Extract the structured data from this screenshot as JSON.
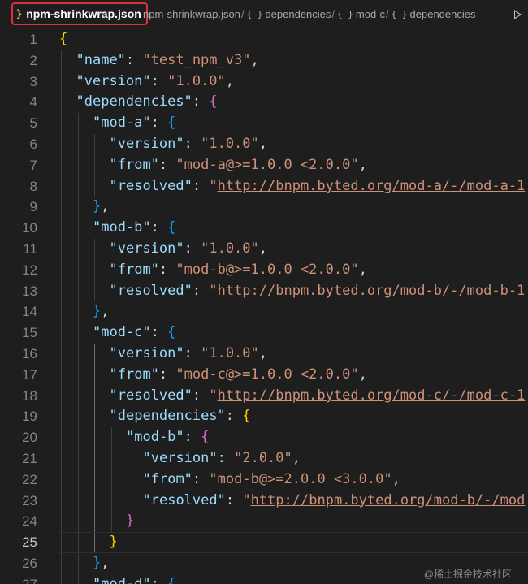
{
  "breadcrumbs": {
    "file": "npm-shrinkwrap.json",
    "file_icon": "}",
    "path": [
      {
        "label": "npm-shrinkwrap.json"
      },
      {
        "label": "dependencies"
      },
      {
        "label": "mod-c"
      },
      {
        "label": "dependencies"
      }
    ],
    "object_icon": "{ }",
    "separator": "/"
  },
  "editor": {
    "current_line": 25,
    "lines": [
      {
        "n": "1",
        "indent": 0,
        "tokens": [
          {
            "t": "{",
            "c": "b1"
          }
        ]
      },
      {
        "n": "2",
        "indent": 1,
        "tokens": [
          {
            "t": "\"name\"",
            "c": "key"
          },
          {
            "t": ": ",
            "c": "p"
          },
          {
            "t": "\"test_npm_v3\"",
            "c": "str"
          },
          {
            "t": ",",
            "c": "p"
          }
        ]
      },
      {
        "n": "3",
        "indent": 1,
        "tokens": [
          {
            "t": "\"version\"",
            "c": "key"
          },
          {
            "t": ": ",
            "c": "p"
          },
          {
            "t": "\"1.0.0\"",
            "c": "str"
          },
          {
            "t": ",",
            "c": "p"
          }
        ]
      },
      {
        "n": "4",
        "indent": 1,
        "tokens": [
          {
            "t": "\"dependencies\"",
            "c": "key"
          },
          {
            "t": ": ",
            "c": "p"
          },
          {
            "t": "{",
            "c": "b2"
          }
        ]
      },
      {
        "n": "5",
        "indent": 2,
        "tokens": [
          {
            "t": "\"mod-a\"",
            "c": "key"
          },
          {
            "t": ": ",
            "c": "p"
          },
          {
            "t": "{",
            "c": "b3"
          }
        ]
      },
      {
        "n": "6",
        "indent": 3,
        "tokens": [
          {
            "t": "\"version\"",
            "c": "key"
          },
          {
            "t": ": ",
            "c": "p"
          },
          {
            "t": "\"1.0.0\"",
            "c": "str"
          },
          {
            "t": ",",
            "c": "p"
          }
        ]
      },
      {
        "n": "7",
        "indent": 3,
        "tokens": [
          {
            "t": "\"from\"",
            "c": "key"
          },
          {
            "t": ": ",
            "c": "p"
          },
          {
            "t": "\"mod-a@>=1.0.0 <2.0.0\"",
            "c": "str"
          },
          {
            "t": ",",
            "c": "p"
          }
        ]
      },
      {
        "n": "8",
        "indent": 3,
        "tokens": [
          {
            "t": "\"resolved\"",
            "c": "key"
          },
          {
            "t": ": ",
            "c": "p"
          },
          {
            "t": "\"",
            "c": "str"
          },
          {
            "t": "http://bnpm.byted.org/mod-a/-/mod-a-1",
            "c": "url"
          }
        ]
      },
      {
        "n": "9",
        "indent": 2,
        "tokens": [
          {
            "t": "}",
            "c": "b3"
          },
          {
            "t": ",",
            "c": "p"
          }
        ]
      },
      {
        "n": "10",
        "indent": 2,
        "tokens": [
          {
            "t": "\"mod-b\"",
            "c": "key"
          },
          {
            "t": ": ",
            "c": "p"
          },
          {
            "t": "{",
            "c": "b3"
          }
        ]
      },
      {
        "n": "11",
        "indent": 3,
        "tokens": [
          {
            "t": "\"version\"",
            "c": "key"
          },
          {
            "t": ": ",
            "c": "p"
          },
          {
            "t": "\"1.0.0\"",
            "c": "str"
          },
          {
            "t": ",",
            "c": "p"
          }
        ]
      },
      {
        "n": "12",
        "indent": 3,
        "tokens": [
          {
            "t": "\"from\"",
            "c": "key"
          },
          {
            "t": ": ",
            "c": "p"
          },
          {
            "t": "\"mod-b@>=1.0.0 <2.0.0\"",
            "c": "str"
          },
          {
            "t": ",",
            "c": "p"
          }
        ]
      },
      {
        "n": "13",
        "indent": 3,
        "tokens": [
          {
            "t": "\"resolved\"",
            "c": "key"
          },
          {
            "t": ": ",
            "c": "p"
          },
          {
            "t": "\"",
            "c": "str"
          },
          {
            "t": "http://bnpm.byted.org/mod-b/-/mod-b-1",
            "c": "url"
          }
        ]
      },
      {
        "n": "14",
        "indent": 2,
        "tokens": [
          {
            "t": "}",
            "c": "b3"
          },
          {
            "t": ",",
            "c": "p"
          }
        ]
      },
      {
        "n": "15",
        "indent": 2,
        "tokens": [
          {
            "t": "\"mod-c\"",
            "c": "key"
          },
          {
            "t": ": ",
            "c": "p"
          },
          {
            "t": "{",
            "c": "b3"
          }
        ]
      },
      {
        "n": "16",
        "indent": 3,
        "tokens": [
          {
            "t": "\"version\"",
            "c": "key"
          },
          {
            "t": ": ",
            "c": "p"
          },
          {
            "t": "\"1.0.0\"",
            "c": "str"
          },
          {
            "t": ",",
            "c": "p"
          }
        ]
      },
      {
        "n": "17",
        "indent": 3,
        "tokens": [
          {
            "t": "\"from\"",
            "c": "key"
          },
          {
            "t": ": ",
            "c": "p"
          },
          {
            "t": "\"mod-c@>=1.0.0 <2.0.0\"",
            "c": "str"
          },
          {
            "t": ",",
            "c": "p"
          }
        ]
      },
      {
        "n": "18",
        "indent": 3,
        "tokens": [
          {
            "t": "\"resolved\"",
            "c": "key"
          },
          {
            "t": ": ",
            "c": "p"
          },
          {
            "t": "\"",
            "c": "str"
          },
          {
            "t": "http://bnpm.byted.org/mod-c/-/mod-c-1",
            "c": "url"
          }
        ]
      },
      {
        "n": "19",
        "indent": 3,
        "tokens": [
          {
            "t": "\"dependencies\"",
            "c": "key"
          },
          {
            "t": ": ",
            "c": "p"
          },
          {
            "t": "{",
            "c": "b1"
          }
        ]
      },
      {
        "n": "20",
        "indent": 4,
        "tokens": [
          {
            "t": "\"mod-b\"",
            "c": "key"
          },
          {
            "t": ": ",
            "c": "p"
          },
          {
            "t": "{",
            "c": "b2"
          }
        ]
      },
      {
        "n": "21",
        "indent": 5,
        "tokens": [
          {
            "t": "\"version\"",
            "c": "key"
          },
          {
            "t": ": ",
            "c": "p"
          },
          {
            "t": "\"2.0.0\"",
            "c": "str"
          },
          {
            "t": ",",
            "c": "p"
          }
        ]
      },
      {
        "n": "22",
        "indent": 5,
        "tokens": [
          {
            "t": "\"from\"",
            "c": "key"
          },
          {
            "t": ": ",
            "c": "p"
          },
          {
            "t": "\"mod-b@>=2.0.0 <3.0.0\"",
            "c": "str"
          },
          {
            "t": ",",
            "c": "p"
          }
        ]
      },
      {
        "n": "23",
        "indent": 5,
        "tokens": [
          {
            "t": "\"resolved\"",
            "c": "key"
          },
          {
            "t": ": ",
            "c": "p"
          },
          {
            "t": "\"",
            "c": "str"
          },
          {
            "t": "http://bnpm.byted.org/mod-b/-/mod",
            "c": "url"
          }
        ]
      },
      {
        "n": "24",
        "indent": 4,
        "tokens": [
          {
            "t": "}",
            "c": "b2"
          }
        ]
      },
      {
        "n": "25",
        "indent": 3,
        "tokens": [
          {
            "t": "}",
            "c": "b1"
          }
        ]
      },
      {
        "n": "26",
        "indent": 2,
        "tokens": [
          {
            "t": "}",
            "c": "b3"
          },
          {
            "t": ",",
            "c": "p"
          }
        ]
      },
      {
        "n": "27",
        "indent": 2,
        "tokens": [
          {
            "t": "\"mod-d\"",
            "c": "key"
          },
          {
            "t": ": ",
            "c": "p"
          },
          {
            "t": "{",
            "c": "b3"
          }
        ]
      }
    ],
    "guides": [
      {
        "col": 0,
        "from": 2,
        "to": 27,
        "active": false
      },
      {
        "col": 1,
        "from": 5,
        "to": 27,
        "active": false
      },
      {
        "col": 2,
        "from": 6,
        "to": 8,
        "active": false
      },
      {
        "col": 2,
        "from": 11,
        "to": 13,
        "active": false
      },
      {
        "col": 2,
        "from": 16,
        "to": 25,
        "active": true
      },
      {
        "col": 3,
        "from": 20,
        "to": 24,
        "active": false
      },
      {
        "col": 4,
        "from": 21,
        "to": 23,
        "active": false
      }
    ]
  },
  "watermark": "@稀土掘金技术社区"
}
